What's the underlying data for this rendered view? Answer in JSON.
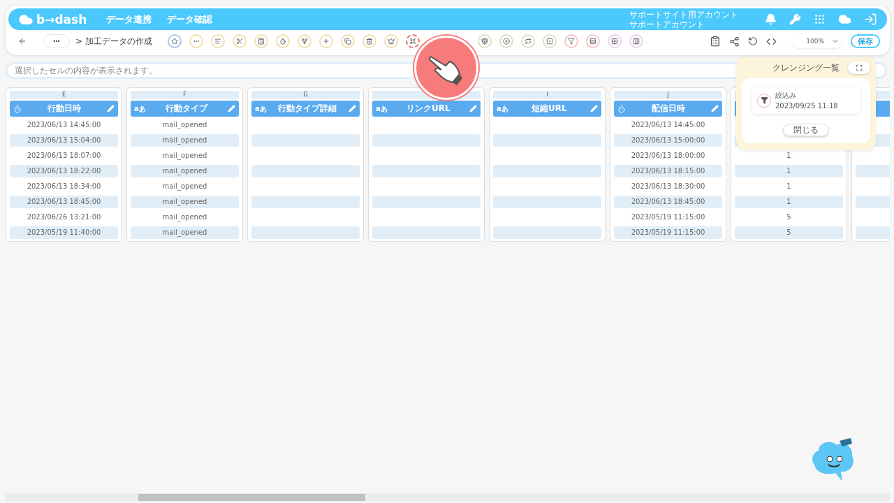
{
  "app": {
    "logo": "b→dash",
    "nav": [
      "データ連携",
      "データ確認"
    ],
    "account": [
      "サポートサイト用アカウント",
      "サポートアカウント"
    ]
  },
  "breadcrumb": {
    "more": "•••",
    "path": "> 加工データの作成"
  },
  "tools": [
    {
      "color": "#a9c6e8",
      "highlighted": false
    },
    {
      "color": "#f3dfae",
      "highlighted": false
    },
    {
      "color": "#f3dfae",
      "highlighted": false
    },
    {
      "color": "#f3dfae",
      "highlighted": false
    },
    {
      "color": "#f3dfae",
      "highlighted": false
    },
    {
      "color": "#f3dfae",
      "highlighted": false
    },
    {
      "color": "#f3dfae",
      "highlighted": false
    },
    {
      "color": "#f3dfae",
      "highlighted": false
    },
    {
      "color": "#f3dfae",
      "highlighted": false
    },
    {
      "color": "#f3dfae",
      "highlighted": false
    },
    {
      "color": "#f3dfae",
      "highlighted": false
    },
    {
      "color": "#f36a6a",
      "highlighted": true
    },
    {
      "color": "#d9e3c4",
      "highlighted": false
    },
    {
      "color": "#d9e3c4",
      "highlighted": false
    },
    {
      "color": "#d9e3c4",
      "highlighted": false
    },
    {
      "color": "#d9e3c4",
      "highlighted": false
    },
    {
      "color": "#f6c6c6",
      "highlighted": false
    },
    {
      "color": "#f6c6c6",
      "highlighted": false
    },
    {
      "color": "#ecd2f3",
      "highlighted": false
    },
    {
      "color": "#ecd2f3",
      "highlighted": false
    }
  ],
  "zoom": {
    "value": "100%"
  },
  "save_button": "保存",
  "formula_bar": {
    "placeholder": "選択したセルの内容が表示されます。"
  },
  "columns": [
    {
      "letter": "E",
      "name": "行動日時",
      "kind": "datetime",
      "cells": [
        "2023/06/13 14:45:00",
        "2023/06/13 15:04:00",
        "2023/06/13 18:07:00",
        "2023/06/13 18:22:00",
        "2023/06/13 18:34:00",
        "2023/06/13 18:45:00",
        "2023/06/26 13:21:00",
        "2023/05/19 11:40:00"
      ]
    },
    {
      "letter": "F",
      "name": "行動タイプ",
      "kind": "text",
      "type_mark": "aあ",
      "cells": [
        "mail_opened",
        "mail_opened",
        "mail_opened",
        "mail_opened",
        "mail_opened",
        "mail_opened",
        "mail_opened",
        "mail_opened"
      ]
    },
    {
      "letter": "G",
      "name": "行動タイプ詳細",
      "kind": "text",
      "type_mark": "aあ",
      "cells": [
        null,
        null,
        null,
        null,
        null,
        null,
        null,
        null
      ]
    },
    {
      "name": "リンクURL",
      "kind": "text",
      "type_mark": "aあ",
      "cells": [
        null,
        null,
        null,
        null,
        null,
        null,
        null,
        null
      ]
    },
    {
      "letter": "I",
      "name": "短縮URL",
      "kind": "text",
      "type_mark": "aあ",
      "cells": [
        null,
        null,
        null,
        null,
        null,
        null,
        null,
        null
      ]
    },
    {
      "letter": "J",
      "name": "配信日時",
      "kind": "datetime",
      "cells": [
        "2023/06/13 14:45:00",
        "2023/06/13 15:00:00",
        "2023/06/13 18:00:00",
        "2023/06/13 18:15:00",
        "2023/06/13 18:30:00",
        "2023/06/13 18:45:00",
        "2023/05/19 11:15:00",
        "2023/05/19 11:15:00"
      ]
    },
    {
      "kind": "number",
      "cells": [
        null,
        null,
        "1",
        "1",
        "1",
        "1",
        "5",
        "5"
      ]
    },
    {
      "kind": "number",
      "cells": [
        null,
        null,
        null,
        null,
        null,
        null,
        null,
        null
      ]
    }
  ],
  "cleansing_panel": {
    "title": "クレンジング一覧",
    "items": [
      {
        "name": "絞込み",
        "date": "2023/09/25 11:18"
      }
    ],
    "close": "閉じる"
  }
}
